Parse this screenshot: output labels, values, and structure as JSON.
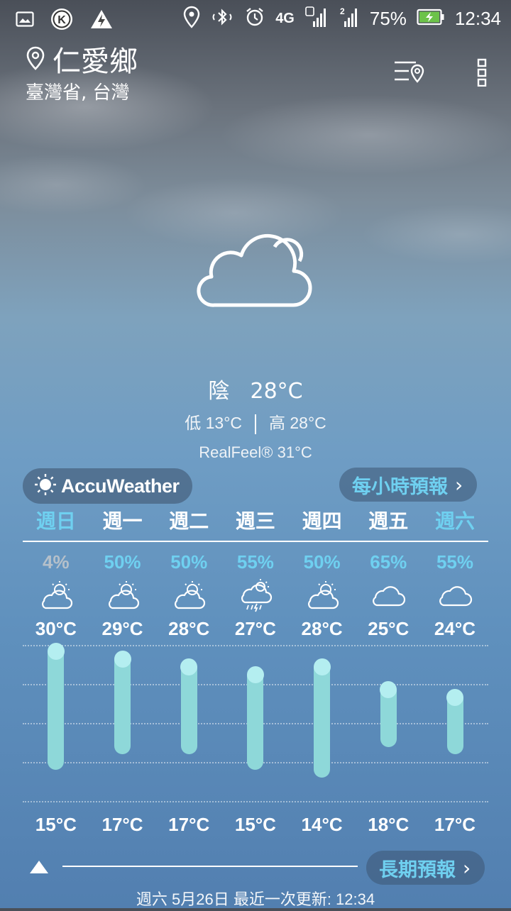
{
  "status_bar": {
    "battery": "75%",
    "time": "12:34",
    "network": "4G",
    "sim1": "1",
    "sim2": "2",
    "icons_left": [
      "image-icon",
      "k-circle-icon",
      "warning-triangle-icon"
    ],
    "icons_right": [
      "location-pin-icon",
      "bluetooth-icon",
      "alarm-icon",
      "signal-icon",
      "battery-charging-icon"
    ]
  },
  "location": {
    "city": "仁愛鄉",
    "region": "臺灣省, 台灣"
  },
  "current": {
    "condition": "陰",
    "temp": "28°C",
    "low_label": "低 13°C",
    "high_label": "高 28°C",
    "realfeel": "RealFeel® 31°C",
    "icon": "cloudy-icon"
  },
  "brand": {
    "name": "AccuWeather"
  },
  "hourly_button": {
    "label": "每小時預報"
  },
  "long_button": {
    "label": "長期預報"
  },
  "forecast": {
    "days": [
      {
        "day": "週日",
        "pct": "4%",
        "high": "30°C",
        "low": "15°C",
        "icon": "partly-sunny-icon",
        "weekend": true,
        "hi_val": 30,
        "lo_val": 15
      },
      {
        "day": "週一",
        "pct": "50%",
        "high": "29°C",
        "low": "17°C",
        "icon": "partly-sunny-icon",
        "weekend": false,
        "hi_val": 29,
        "lo_val": 17
      },
      {
        "day": "週二",
        "pct": "50%",
        "high": "28°C",
        "low": "17°C",
        "icon": "partly-sunny-icon",
        "weekend": false,
        "hi_val": 28,
        "lo_val": 17
      },
      {
        "day": "週三",
        "pct": "55%",
        "high": "27°C",
        "low": "15°C",
        "icon": "thunder-shower-icon",
        "weekend": false,
        "hi_val": 27,
        "lo_val": 15
      },
      {
        "day": "週四",
        "pct": "50%",
        "high": "28°C",
        "low": "14°C",
        "icon": "partly-sunny-icon",
        "weekend": false,
        "hi_val": 28,
        "lo_val": 14
      },
      {
        "day": "週五",
        "pct": "65%",
        "high": "25°C",
        "low": "18°C",
        "icon": "cloud-icon",
        "weekend": false,
        "hi_val": 25,
        "lo_val": 18
      },
      {
        "day": "週六",
        "pct": "55%",
        "high": "24°C",
        "low": "17°C",
        "icon": "cloud-icon",
        "weekend": true,
        "hi_val": 24,
        "lo_val": 17
      }
    ]
  },
  "footer": {
    "updated": "週六 5月26日 最近一次更新: 12:34"
  },
  "colors": {
    "accent": "#6fd0f0",
    "bar": "#8ed8d9",
    "bar_cap": "#b4eef0"
  }
}
